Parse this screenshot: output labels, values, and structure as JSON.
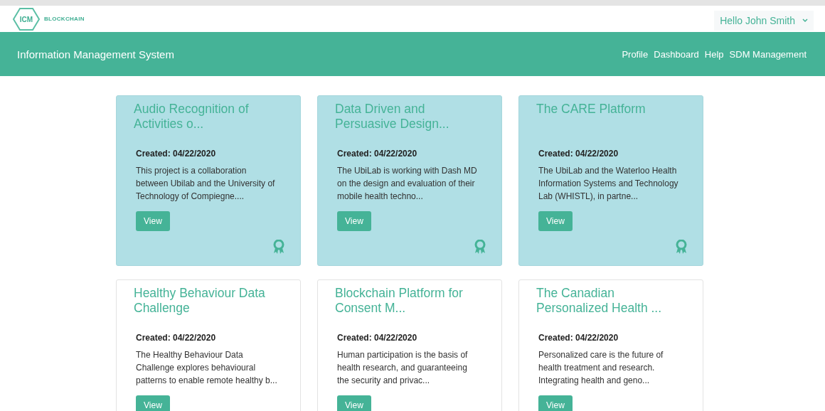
{
  "header": {
    "logo_mark": "ICM",
    "logo_text": "BLOCKCHAIN",
    "user_menu": "Hello John Smith"
  },
  "navbar": {
    "title": "Information Management System",
    "links": [
      "Profile",
      "Dashboard",
      "Help",
      "SDM Management"
    ]
  },
  "projects": [
    {
      "title": "Audio Recognition of Activities o...",
      "created": "Created: 04/22/2020",
      "description": "This project is a collaboration between Ubilab and the University of Technology of Compiegne....",
      "button": "View",
      "featured": true
    },
    {
      "title": "Data Driven and Persuasive Design...",
      "created": "Created: 04/22/2020",
      "description": "The UbiLab is working with Dash MD on the design and evaluation of their mobile health techno...",
      "button": "View",
      "featured": true
    },
    {
      "title": "The CARE Platform",
      "created": "Created: 04/22/2020",
      "description": "The UbiLab and the Waterloo Health Information Systems and Technology Lab (WHISTL), in partne...",
      "button": "View",
      "featured": true
    },
    {
      "title": "Healthy Behaviour Data Challenge",
      "created": "Created: 04/22/2020",
      "description": "The Healthy Behaviour Data Challenge explores behavioural patterns to enable remote healthy b...",
      "button": "View",
      "featured": false
    },
    {
      "title": "Blockchain Platform for Consent M...",
      "created": "Created: 04/22/2020",
      "description": "Human participation is the basis of health research, and guaranteeing the security and privac...",
      "button": "View",
      "featured": false
    },
    {
      "title": "The Canadian Personalized Health ...",
      "created": "Created: 04/22/2020",
      "description": "Personalized care is the future of health treatment and research. Integrating health and geno...",
      "button": "View",
      "featured": false
    }
  ]
}
